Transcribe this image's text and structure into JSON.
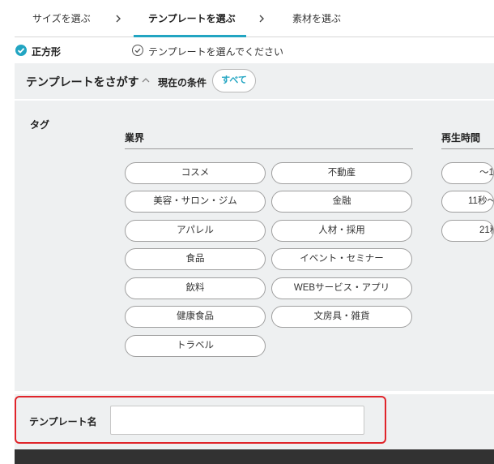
{
  "steps": {
    "items": [
      {
        "label": "サイズを選ぶ"
      },
      {
        "label": "テンプレートを選ぶ"
      },
      {
        "label": "素材を選ぶ"
      }
    ],
    "active_index": 1,
    "accent_color": "#22a5c2"
  },
  "status": {
    "size_label": "正方形",
    "template_message": "テンプレートを選んでください"
  },
  "search": {
    "title": "テンプレートをさがす",
    "condition_label": "現在の条件",
    "condition_value": "すべて"
  },
  "tags": {
    "label": "タグ",
    "industry": {
      "title": "業界",
      "items": [
        "コスメ",
        "不動産",
        "美容・サロン・ジム",
        "金融",
        "アパレル",
        "人材・採用",
        "食品",
        "イベント・セミナー",
        "飲料",
        "WEBサービス・アプリ",
        "健康食品",
        "文房具・雑貨",
        "トラベル"
      ]
    },
    "duration": {
      "title": "再生時間",
      "items": [
        "〜1",
        "11秒〜",
        "21秒"
      ]
    }
  },
  "template_name": {
    "label": "テンプレート名",
    "value": "",
    "placeholder": ""
  }
}
